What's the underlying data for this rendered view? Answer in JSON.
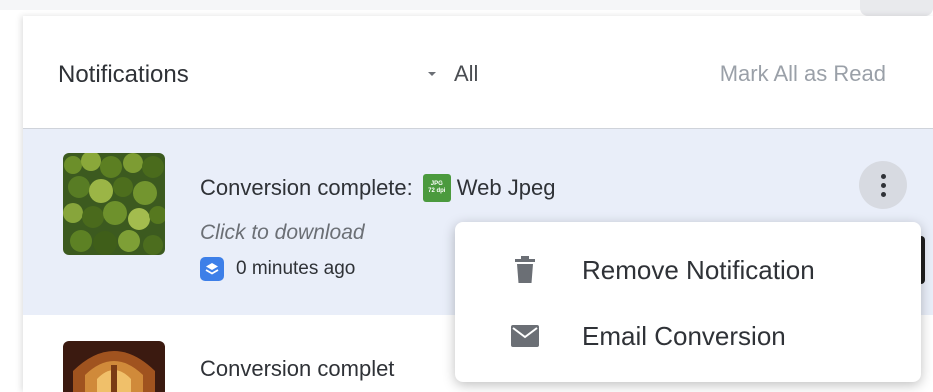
{
  "header": {
    "title": "Notifications",
    "filter_value": "All",
    "mark_all_label": "Mark All as Read"
  },
  "notifications": [
    {
      "title_prefix": "Conversion complete:",
      "format_badge": [
        "JPG",
        "72 dpi"
      ],
      "format_name": "Web Jpeg",
      "subtitle": "Click to download",
      "time": "0 minutes ago"
    },
    {
      "title_prefix": "Conversion complet"
    }
  ],
  "context_menu": {
    "items": [
      {
        "label": "Remove Notification",
        "icon": "trash-icon"
      },
      {
        "label": "Email Conversion",
        "icon": "mail-icon"
      }
    ]
  },
  "colors": {
    "selected_row_bg": "#e9eef9",
    "badge_green": "#4b9a3e",
    "layers_blue": "#3d7fe8"
  }
}
